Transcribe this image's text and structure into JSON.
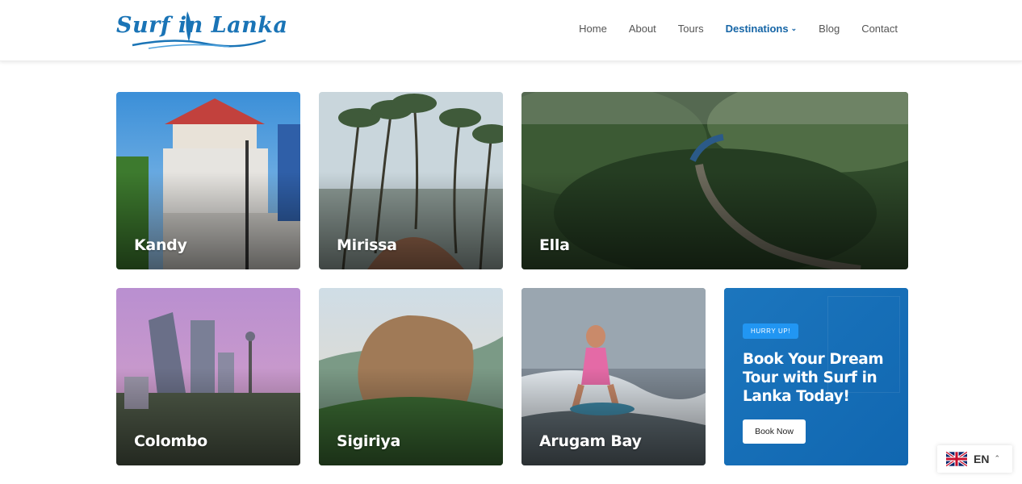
{
  "brand": {
    "logo_text": "Surf in Lanka",
    "color": "#1a74b6"
  },
  "nav": {
    "items": [
      {
        "label": "Home"
      },
      {
        "label": "About"
      },
      {
        "label": "Tours"
      },
      {
        "label": "Destinations",
        "active": true
      },
      {
        "label": "Blog"
      },
      {
        "label": "Contact"
      }
    ],
    "active_color": "#1565a6"
  },
  "destinations": [
    {
      "name": "Kandy"
    },
    {
      "name": "Mirissa"
    },
    {
      "name": "Ella"
    },
    {
      "name": "Colombo"
    },
    {
      "name": "Sigiriya"
    },
    {
      "name": "Arugam Bay"
    }
  ],
  "promo": {
    "badge": "HURRY UP!",
    "title": "Book Your Dream Tour with Surf in Lanka Today!",
    "button": "Book Now",
    "background": "#1a73b8"
  },
  "language": {
    "code": "EN",
    "flag_icon": "uk-flag-icon"
  }
}
